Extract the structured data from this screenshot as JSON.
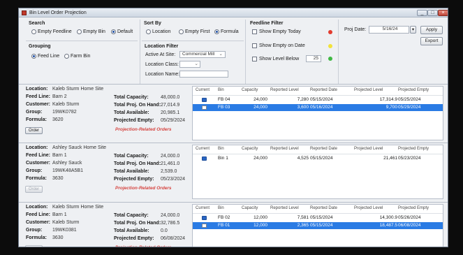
{
  "window": {
    "title": "Bin Level Order Projection",
    "controls": [
      "_",
      "□",
      "×"
    ]
  },
  "search": {
    "label": "Search",
    "options": [
      "Empty Feedline",
      "Empty Bin",
      "Default"
    ],
    "selected": "Default"
  },
  "sort_by": {
    "label": "Sort By",
    "options": [
      "Location",
      "Empty First",
      "Formula"
    ],
    "selected": "Formula"
  },
  "grouping": {
    "label": "Grouping",
    "options": [
      "Feed Line",
      "Farm Bin"
    ],
    "selected": "Feed Line"
  },
  "location_filter": {
    "label": "Location Filter",
    "active_site_label": "Active At Site:",
    "active_site_value": "Commercial Mill",
    "class_label": "Location Class:",
    "class_value": "",
    "name_label": "Location Name:",
    "name_value": ""
  },
  "feedline_filter": {
    "label": "Feedline Filter",
    "show_empty_today": "Show Empty Today",
    "show_empty_on_date": "Show Empty on Date",
    "show_level_below": "Show Level Below",
    "level_below_value": "25",
    "colors": [
      "#e23b2e",
      "#f2e23a",
      "#3fb843"
    ]
  },
  "proj_date": {
    "label": "Proj Date:",
    "value": "5/16/24"
  },
  "buttons": {
    "apply": "Apply",
    "export": "Export"
  },
  "info_labels": {
    "location": "Location:",
    "feed_line": "Feed Line:",
    "customer": "Customer:",
    "group": "Group:",
    "formula": "Formula:",
    "total_capacity": "Total Capacity:",
    "total_on_hand": "Total Proj. On Hand:",
    "total_available": "Total Available:",
    "projected_empty": "Projected Empty:",
    "projection_related": "Projection-Related Orders",
    "order_button": "Order"
  },
  "table_headers": [
    "Current",
    "Bin",
    "Capacity",
    "Reported Level",
    "Reported Date",
    "Projected Level",
    "Projected Empty"
  ],
  "groups": [
    {
      "location": "Kaleb Sturm Home Site",
      "feed_line": "Barn 2",
      "customer": "Kaleb Sturm",
      "group": "19WK0782",
      "formula": "3620",
      "total_capacity": "48,000.0",
      "total_on_hand": "27,014.9",
      "total_available": "20,985.1",
      "projected_empty": "05/29/2024",
      "order_enabled": true,
      "rows": [
        {
          "current": true,
          "bin": "FB 04",
          "capacity": "24,000",
          "reported_level": "7,280",
          "reported_date": "05/15/2024",
          "projected_level": "17,314.9",
          "projected_empty": "05/25/2024",
          "selected": false
        },
        {
          "current": false,
          "bin": "FB 03",
          "capacity": "24,000",
          "reported_level": "3,600",
          "reported_date": "05/16/2024",
          "projected_level": "9,700",
          "projected_empty": "05/29/2024",
          "selected": true
        }
      ]
    },
    {
      "location": "Ashley Sauck Home Site",
      "feed_line": "Barn 1",
      "customer": "Ashley Sauck",
      "group": "19WK48A5B1",
      "formula": "3630",
      "total_capacity": "24,000.0",
      "total_on_hand": "21,461.0",
      "total_available": "2,539.0",
      "projected_empty": "05/23/2024",
      "order_enabled": false,
      "rows": [
        {
          "current": true,
          "bin": "Bin 1",
          "capacity": "24,000",
          "reported_level": "4,525",
          "reported_date": "05/15/2024",
          "projected_level": "21,461",
          "projected_empty": "05/23/2024",
          "selected": false
        }
      ]
    },
    {
      "location": "Kaleb Sturm Home Site",
      "feed_line": "Barn 1",
      "customer": "Kaleb Sturm",
      "group": "19WK0381",
      "formula": "3630",
      "total_capacity": "24,000.0",
      "total_on_hand": "32,786.5",
      "total_available": "0.0",
      "projected_empty": "06/08/2024",
      "order_enabled": false,
      "rows": [
        {
          "current": true,
          "bin": "FB 02",
          "capacity": "12,000",
          "reported_level": "7,581",
          "reported_date": "05/15/2024",
          "projected_level": "14,300.9",
          "projected_empty": "05/26/2024",
          "selected": false
        },
        {
          "current": false,
          "bin": "FB 01",
          "capacity": "12,000",
          "reported_level": "2,365",
          "reported_date": "05/15/2024",
          "projected_level": "18,487.5",
          "projected_empty": "06/08/2024",
          "selected": true
        }
      ]
    }
  ]
}
